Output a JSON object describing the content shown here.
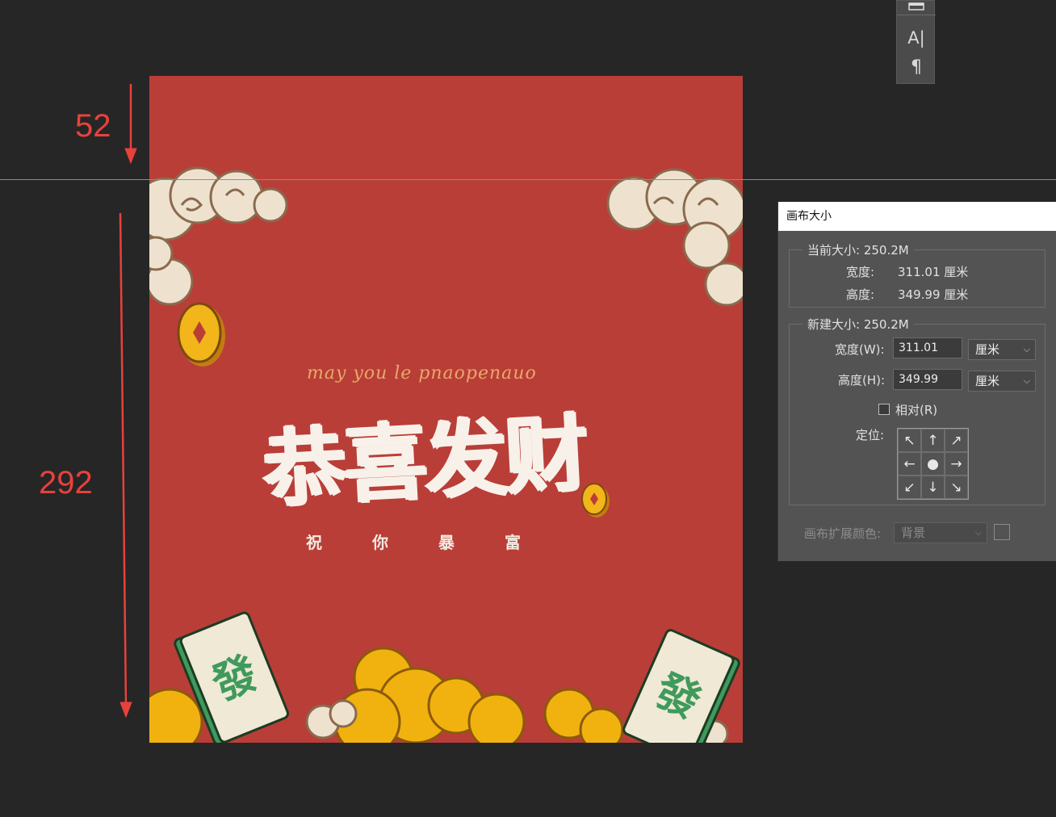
{
  "annotations": {
    "top_measure": "52",
    "side_measure": "292"
  },
  "tools_panel": {
    "type_tool_glyph": "A|",
    "paragraph_glyph": "¶"
  },
  "artwork": {
    "script_line": "may you le pnaopenauo",
    "headline": "恭喜发财",
    "sub_chars": [
      "祝",
      "你",
      "暴",
      "富"
    ],
    "tile_char": "發"
  },
  "dialog": {
    "title": "画布大小",
    "current": {
      "legend": "当前大小: 250.2M",
      "width_label": "宽度:",
      "width_value": "311.01 厘米",
      "height_label": "高度:",
      "height_value": "349.99 厘米"
    },
    "new": {
      "legend": "新建大小: 250.2M",
      "width_label": "宽度(W):",
      "width_value": "311.01",
      "width_unit": "厘米",
      "height_label": "高度(H):",
      "height_value": "349.99",
      "height_unit": "厘米",
      "relative_label": "相对(R)",
      "relative_checked": false,
      "anchor_label": "定位:"
    },
    "extension": {
      "label": "画布扩展颜色:",
      "value": "背景"
    }
  },
  "colors": {
    "canvas_red": "#b93e37",
    "guide_cyan": "#2ab6c2",
    "annotation_red": "#e8413c",
    "coin_gold": "#f2b51a",
    "tile_green": "#3f9a5c"
  }
}
